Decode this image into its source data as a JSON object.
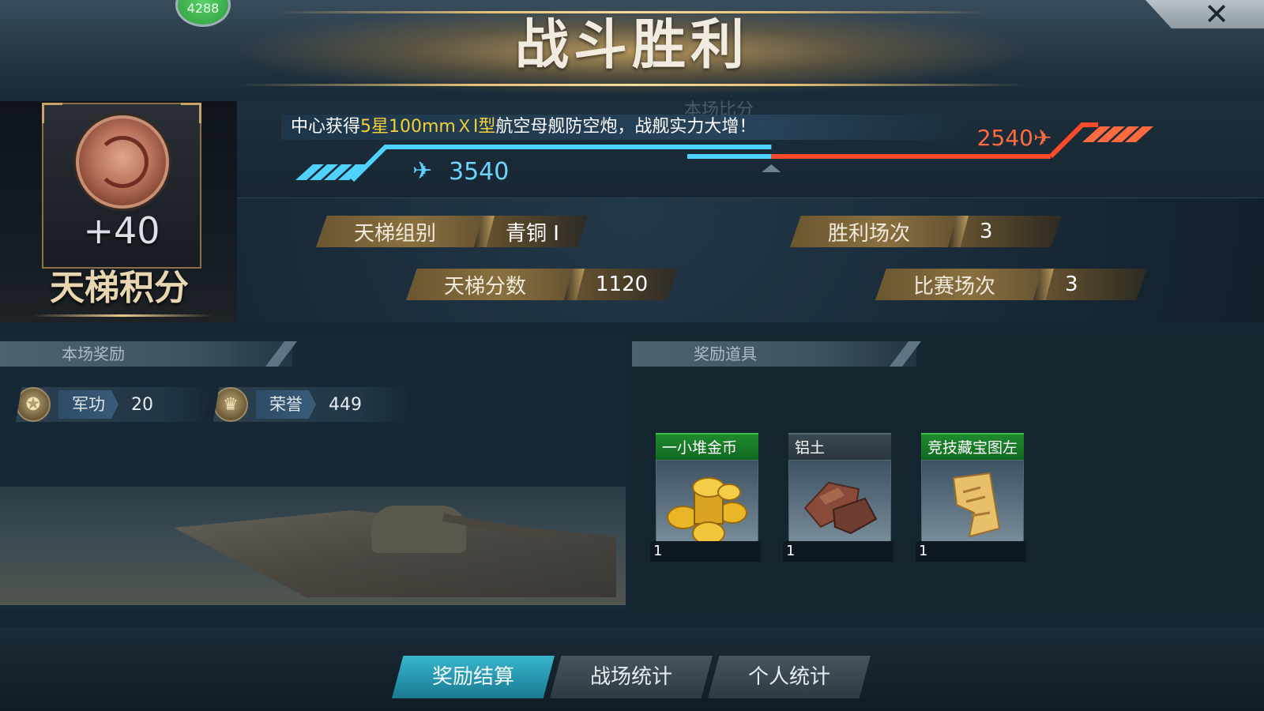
{
  "header": {
    "title": "战斗胜利",
    "badge_text": "4288"
  },
  "emblem": {
    "points_gain": "+40",
    "label": "天梯积分"
  },
  "score": {
    "ghost_label": "本场比分",
    "notice_prefix": "中心获得",
    "notice_highlight": "5星100mmＸⅠ型",
    "notice_suffix": "航空母舰防空炮，战舰实力大增！",
    "blue_score": "3540",
    "red_score": "2540",
    "blue_ratio": 0.58
  },
  "stats": {
    "ladder_group_label": "天梯组别",
    "ladder_group_value": "青铜 I",
    "ladder_score_label": "天梯分数",
    "ladder_score_value": "1120",
    "wins_label": "胜利场次",
    "wins_value": "3",
    "matches_label": "比赛场次",
    "matches_value": "3"
  },
  "rewards": {
    "section_title": "本场奖励",
    "merit_label": "军功",
    "merit_value": "20",
    "honor_label": "荣誉",
    "honor_value": "449"
  },
  "items": {
    "section_title": "奖励道具",
    "list": [
      {
        "name": "一小堆金币",
        "qty": "1",
        "icon": "gold-coins-icon"
      },
      {
        "name": "铝土",
        "qty": "1",
        "icon": "bauxite-ore-icon"
      },
      {
        "name": "竞技藏宝图左",
        "qty": "1",
        "icon": "treasure-map-icon"
      }
    ]
  },
  "tabs": {
    "reward_settlement": "奖励结算",
    "battle_stats": "战场统计",
    "personal_stats": "个人统计"
  },
  "colors": {
    "blue_team": "#4fd2ff",
    "red_team": "#ff4a2a",
    "active_tab": "#2aa0b8",
    "gold": "#e8c276"
  }
}
